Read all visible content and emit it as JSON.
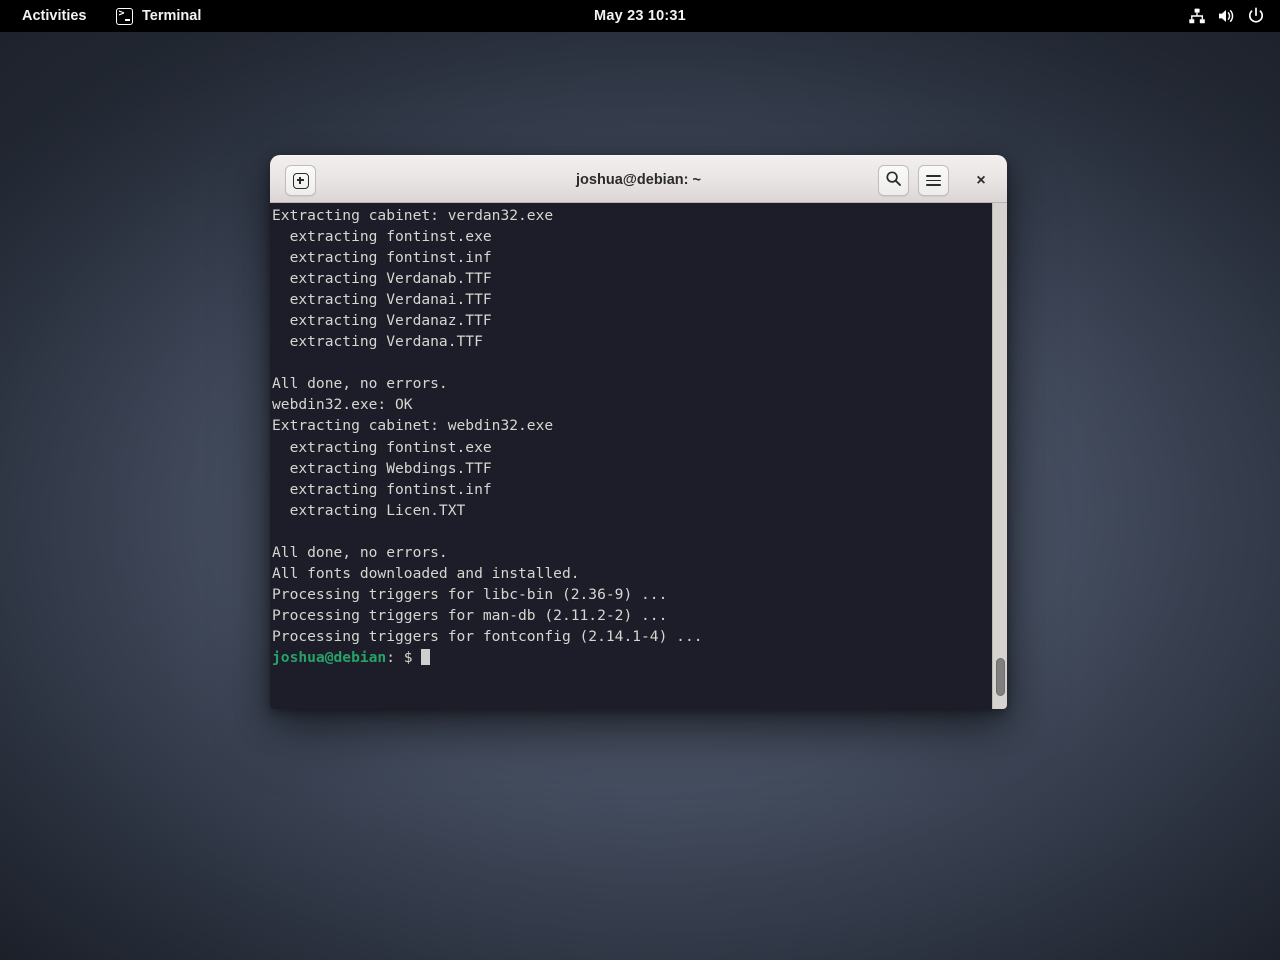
{
  "topbar": {
    "activities_label": "Activities",
    "app_name": "Terminal",
    "app_icon": "terminal-icon",
    "clock": "May 23  10:31",
    "system_icons": [
      "network-wired-icon",
      "volume-icon",
      "power-icon"
    ],
    "background_color": "#000000"
  },
  "desktop": {
    "background_color": "#434c5e"
  },
  "window": {
    "title": "joshua@debian: ~",
    "titlebar": {
      "new_tab_label": "+",
      "search_icon": "search-icon",
      "menu_icon": "hamburger-menu-icon",
      "close_label": "×"
    },
    "terminal": {
      "background_color": "#1d1d29",
      "foreground_color": "#d3d7cf",
      "prompt_color": "#26a269",
      "lines": [
        "Extracting cabinet: verdan32.exe",
        "  extracting fontinst.exe",
        "  extracting fontinst.inf",
        "  extracting Verdanab.TTF",
        "  extracting Verdanai.TTF",
        "  extracting Verdanaz.TTF",
        "  extracting Verdana.TTF",
        "",
        "All done, no errors.",
        "webdin32.exe: OK",
        "Extracting cabinet: webdin32.exe",
        "  extracting fontinst.exe",
        "  extracting Webdings.TTF",
        "  extracting fontinst.inf",
        "  extracting Licen.TXT",
        "",
        "All done, no errors.",
        "All fonts downloaded and installed.",
        "Processing triggers for libc-bin (2.36-9) ...",
        "Processing triggers for man-db (2.11.2-2) ...",
        "Processing triggers for fontconfig (2.14.1-4) ..."
      ],
      "prompt": {
        "user_host": "joshua@debian",
        "separator": ": $ ",
        "cursor": "block-cursor"
      }
    },
    "scrollbar": {
      "position": "bottom"
    }
  }
}
